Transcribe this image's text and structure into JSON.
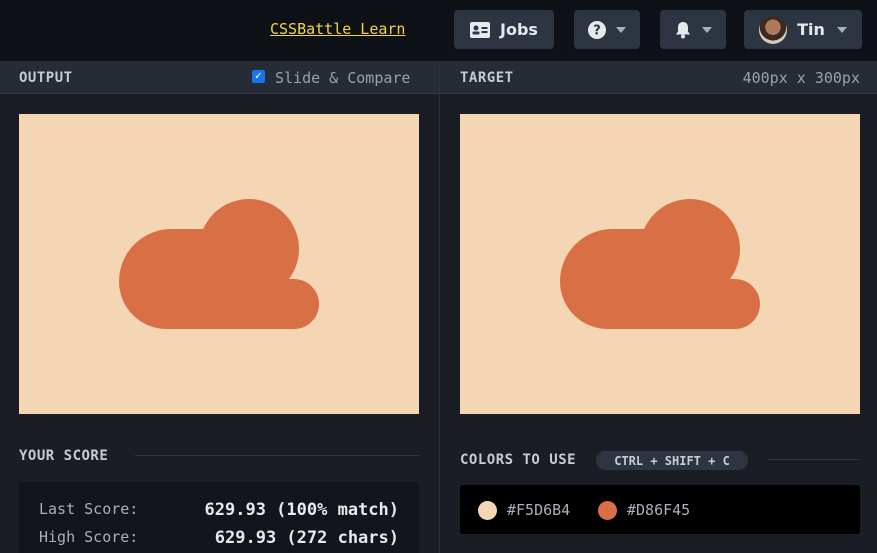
{
  "topbar": {
    "learn_link": "CSSBattle Learn",
    "jobs_label": "Jobs",
    "user_name": "Tin",
    "icons": {
      "jobs": "id-card-icon",
      "help": "question-circle-icon",
      "bell": "bell-icon",
      "caret": "chevron-down-icon"
    }
  },
  "output_panel": {
    "title": "OUTPUT",
    "compare_label": "Slide & Compare",
    "compare_checked": true
  },
  "target_panel": {
    "title": "TARGET",
    "size_label": "400px x 300px"
  },
  "score": {
    "title": "YOUR SCORE",
    "last_label": "Last Score:",
    "last_value": "629.93 (100% match)",
    "high_label": "High Score:",
    "high_value": "629.93 (272 chars)"
  },
  "colors": {
    "title": "COLORS TO USE",
    "shortcut": "CTRL + SHIFT + C",
    "items": [
      {
        "hex": "#F5D6B4",
        "label": "#F5D6B4"
      },
      {
        "hex": "#D86F45",
        "label": "#D86F45"
      }
    ]
  },
  "theme": {
    "background": "#F5D6B4",
    "accent": "#D86F45",
    "link": "#F2D54A"
  }
}
